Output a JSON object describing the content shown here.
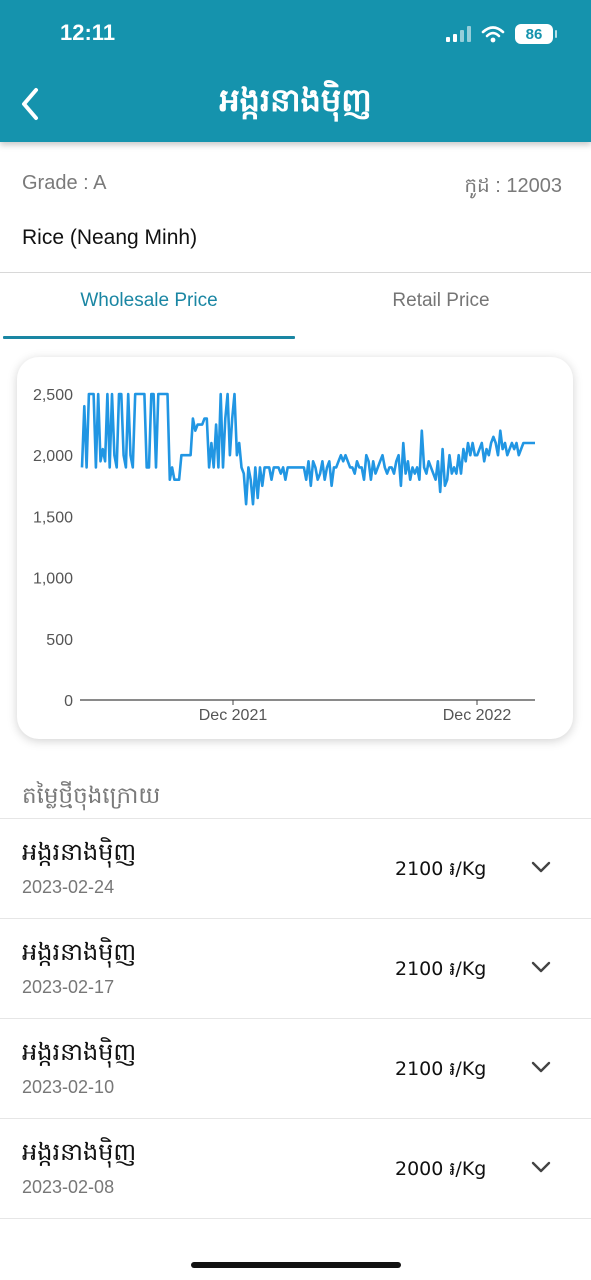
{
  "status_bar": {
    "time": "12:11",
    "battery": "86"
  },
  "app_bar": {
    "title": "អង្ករនាងម៉ិញ"
  },
  "info": {
    "grade": "Grade : A",
    "code": "កូដ : 12003",
    "product": "Rice (Neang Minh)"
  },
  "tabs": [
    {
      "label": "Wholesale Price",
      "active": true
    },
    {
      "label": "Retail Price",
      "active": false
    }
  ],
  "colors": {
    "accent": "#1593ad",
    "tab_active": "#1a86a3",
    "series": "#2196e3"
  },
  "chart_data": {
    "type": "line",
    "x_axis": {
      "ticks": [
        "Dec 2021",
        "Dec 2022"
      ],
      "tick_dates": [
        "2021-12-01",
        "2022-12-01"
      ]
    },
    "y_axis": {
      "ticks": [
        "0",
        "500",
        "1,000",
        "1,500",
        "2,000",
        "2,500"
      ],
      "ylim": [
        0,
        2600
      ]
    },
    "grid": false,
    "series": [
      {
        "values": [
          1900,
          2400,
          1900,
          2500,
          2500,
          2500,
          1900,
          2500,
          1950,
          2050,
          1950,
          2500,
          1900,
          2500,
          2000,
          1900,
          2500,
          2500,
          2000,
          1900,
          2500,
          2000,
          1900,
          2500,
          2500,
          2500,
          2500,
          2500,
          1900,
          1900,
          2500,
          2500,
          1900,
          2500,
          2500,
          2500,
          2500,
          2500,
          1800,
          1900,
          1800,
          1800,
          1800,
          2000,
          2000,
          2000,
          2000,
          2000,
          2300,
          2200,
          2250,
          2250,
          2250,
          2300,
          2300,
          1900,
          2100,
          1900,
          2250,
          1900,
          2500,
          1900,
          2300,
          2500,
          2000,
          2300,
          2500,
          2000,
          2100,
          1900,
          1850,
          1600,
          1900,
          1800,
          1600,
          1900,
          1650,
          1900,
          1750,
          1900,
          1900,
          1900,
          1800,
          1900,
          1900,
          1900,
          1850,
          1900,
          1800,
          1900,
          1900,
          1900,
          1900,
          1900,
          1900,
          1900,
          1900,
          1800,
          1950,
          1750,
          1950,
          1900,
          1800,
          1850,
          1950,
          1800,
          1900,
          1950,
          1750,
          1900,
          1900,
          1950,
          2000,
          1950,
          2000,
          1950,
          1900,
          1900,
          1850,
          1950,
          1900,
          1900,
          1800,
          2000,
          1950,
          1800,
          1950,
          1850,
          1900,
          1950,
          2000,
          1900,
          1850,
          1900,
          1900,
          1850,
          1950,
          2000,
          1750,
          2100,
          1850,
          1950,
          1800,
          1900,
          1850,
          1900,
          1800,
          2200,
          1900,
          1850,
          1950,
          1900,
          1850,
          1800,
          1950,
          1700,
          2050,
          1750,
          1800,
          2000,
          1850,
          1900,
          1850,
          2000,
          1850,
          2050,
          1950,
          2100,
          2000,
          2100,
          2000,
          2000,
          2050,
          2100,
          1950,
          2050,
          2000,
          2100,
          2150,
          2100,
          2000,
          2200,
          2050,
          2100,
          2000,
          2050,
          2100,
          2050,
          2100,
          2000,
          2050,
          2100,
          2100,
          2100,
          2100,
          2100,
          2100
        ]
      }
    ]
  },
  "latest": {
    "title": "តម្លៃថ្មីចុងក្រោយ",
    "items": [
      {
        "name": "អង្ករនាងម៉ិញ",
        "date": "2023-02-24",
        "price": "2100 ៛/Kg"
      },
      {
        "name": "អង្ករនាងម៉ិញ",
        "date": "2023-02-17",
        "price": "2100 ៛/Kg"
      },
      {
        "name": "អង្ករនាងម៉ិញ",
        "date": "2023-02-10",
        "price": "2100 ៛/Kg"
      },
      {
        "name": "អង្ករនាងម៉ិញ",
        "date": "2023-02-08",
        "price": "2000 ៛/Kg"
      }
    ]
  }
}
